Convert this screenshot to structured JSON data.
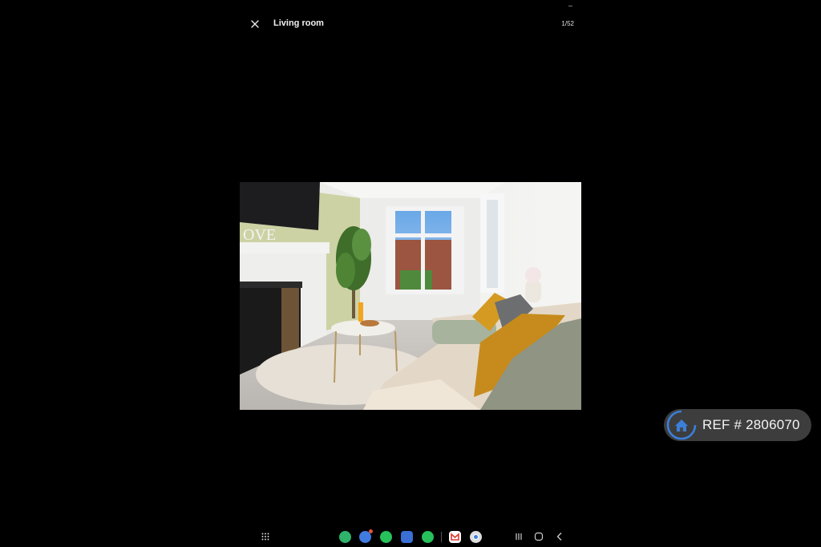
{
  "viewer": {
    "title": "Living room",
    "counter": "1/52"
  },
  "watermark": {
    "ref_text": "REF # 2806070",
    "logo_icon": "house-refresh-icon"
  },
  "colors": {
    "badge_bg": "#474747",
    "logo_blue": "#3b7fd9",
    "sofa": "#e6dccd",
    "cushion_mustard": "#c98f1e",
    "wall_sage": "#cfd3a8"
  },
  "taskbar": {
    "apps": [
      {
        "name": "phone-app-icon",
        "color": "#2fb36a"
      },
      {
        "name": "messages-app-icon",
        "color": "#3f7be0"
      },
      {
        "name": "whatsapp-app-icon",
        "color": "#27c15b"
      },
      {
        "name": "files-app-icon",
        "color": "#3a6fd6"
      },
      {
        "name": "whatsapp-business-app-icon",
        "color": "#27c15b"
      },
      {
        "name": "gmail-app-icon",
        "color": "#ffffff"
      },
      {
        "name": "chrome-app-icon",
        "color": "#dddddd"
      }
    ]
  }
}
